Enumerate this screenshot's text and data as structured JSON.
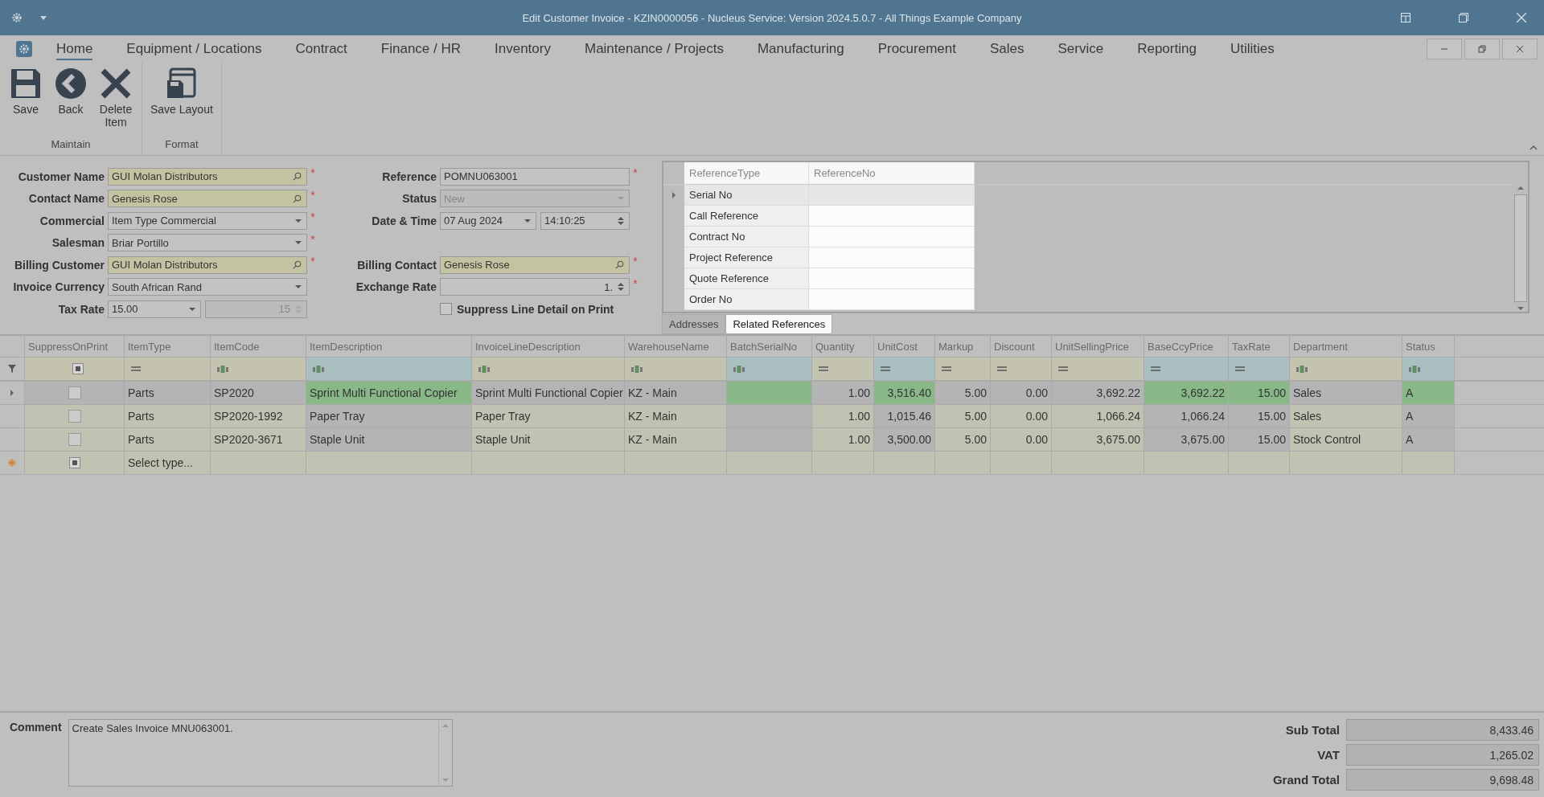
{
  "window": {
    "title": "Edit Customer Invoice - KZIN0000056 - Nucleus Service: Version 2024.5.0.7 - All Things Example Company"
  },
  "menu_tabs": [
    {
      "label": "Home",
      "selected": true
    },
    {
      "label": "Equipment / Locations",
      "selected": false
    },
    {
      "label": "Contract",
      "selected": false
    },
    {
      "label": "Finance / HR",
      "selected": false
    },
    {
      "label": "Inventory",
      "selected": false
    },
    {
      "label": "Maintenance / Projects",
      "selected": false
    },
    {
      "label": "Manufacturing",
      "selected": false
    },
    {
      "label": "Procurement",
      "selected": false
    },
    {
      "label": "Sales",
      "selected": false
    },
    {
      "label": "Service",
      "selected": false
    },
    {
      "label": "Reporting",
      "selected": false
    },
    {
      "label": "Utilities",
      "selected": false
    }
  ],
  "ribbon_groups": [
    {
      "label": "Maintain",
      "buttons": [
        {
          "kind": "save",
          "label": "Save"
        },
        {
          "kind": "back",
          "label": "Back"
        },
        {
          "kind": "delete",
          "label": "Delete Item"
        }
      ]
    },
    {
      "label": "Format",
      "buttons": [
        {
          "kind": "layout",
          "label": "Save Layout"
        }
      ]
    }
  ],
  "form_rows": [
    {
      "left": {
        "label": "Customer Name",
        "required_mark": "*",
        "fields": [
          {
            "kind": "search",
            "value": "GUI Molan Distributors",
            "disabled": false
          }
        ]
      },
      "right": {
        "label": "Reference",
        "required_mark": "*",
        "fields": [
          {
            "kind": "text",
            "value": "POMNU063001",
            "disabled": false
          }
        ]
      }
    },
    {
      "left": {
        "label": "Contact Name",
        "required_mark": "*",
        "fields": [
          {
            "kind": "search",
            "value": "Genesis Rose",
            "disabled": false
          }
        ]
      },
      "right": {
        "label": "Status",
        "fields": [
          {
            "kind": "dropdown",
            "value": "New",
            "disabled": true
          }
        ]
      }
    },
    {
      "left": {
        "label": "Commercial",
        "required_mark": "*",
        "fields": [
          {
            "kind": "dropdown",
            "value": "Item Type Commercial",
            "disabled": false
          }
        ]
      },
      "right": {
        "label": "Date & Time",
        "fields": [
          {
            "kind": "dropdown",
            "value": "07 Aug 2024",
            "disabled": false
          },
          {
            "kind": "spin",
            "value": "14:10:25",
            "disabled": false
          }
        ]
      }
    },
    {
      "left": {
        "label": "Salesman",
        "required_mark": "*",
        "fields": [
          {
            "kind": "dropdown",
            "value": "Briar Portillo",
            "disabled": false
          }
        ]
      }
    },
    {
      "left": {
        "label": "Billing Customer",
        "required_mark": "*",
        "fields": [
          {
            "kind": "search",
            "value": "GUI Molan Distributors",
            "disabled": false
          }
        ]
      },
      "right": {
        "label": "Billing Contact",
        "required_mark": "*",
        "fields": [
          {
            "kind": "search",
            "value": "Genesis Rose",
            "disabled": false
          }
        ]
      }
    },
    {
      "left": {
        "label": "Invoice Currency",
        "fields": [
          {
            "kind": "dropdown",
            "value": "South African Rand",
            "disabled": false
          }
        ]
      },
      "right": {
        "label": "Exchange Rate",
        "required_mark": "*",
        "fields": [
          {
            "kind": "spin-number",
            "value": "1.",
            "disabled": false
          }
        ]
      }
    },
    {
      "left": {
        "label": "Tax Rate",
        "fields": [
          {
            "kind": "dropdown",
            "value": "15.00",
            "disabled": false
          },
          {
            "kind": "spin-number",
            "value": "15",
            "disabled": true
          }
        ]
      },
      "right": {
        "checkbox": {
          "label": "Suppress Line Detail on Print",
          "checked": false
        }
      }
    }
  ],
  "references": {
    "columns": [
      "ReferenceType",
      "ReferenceNo"
    ],
    "rows": [
      {
        "type": "Serial No",
        "selected": true
      },
      {
        "type": "Call Reference",
        "selected": false
      },
      {
        "type": "Contract No",
        "selected": false
      },
      {
        "type": "Project Reference",
        "selected": false
      },
      {
        "type": "Quote Reference",
        "selected": false
      },
      {
        "type": "Order No",
        "selected": false
      }
    ],
    "tabs": [
      {
        "label": "Addresses",
        "selected": false
      },
      {
        "label": "Related References",
        "selected": true
      }
    ]
  },
  "grid": {
    "columns": [
      {
        "label": "SuppressOnPrint",
        "kind": "check",
        "highlighted": false
      },
      {
        "label": "ItemType",
        "kind": "text",
        "highlighted": false
      },
      {
        "label": "ItemCode",
        "kind": "text",
        "highlighted": false
      },
      {
        "label": "ItemDescription",
        "kind": "text",
        "highlighted": true
      },
      {
        "label": "InvoiceLineDescription",
        "kind": "text",
        "highlighted": false
      },
      {
        "label": "WarehouseName",
        "kind": "text",
        "highlighted": false
      },
      {
        "label": "BatchSerialNo",
        "kind": "text",
        "highlighted": true
      },
      {
        "label": "Quantity",
        "kind": "number",
        "highlighted": false
      },
      {
        "label": "UnitCost",
        "kind": "number",
        "highlighted": true
      },
      {
        "label": "Markup",
        "kind": "number",
        "highlighted": false
      },
      {
        "label": "Discount",
        "kind": "number",
        "highlighted": false
      },
      {
        "label": "UnitSellingPrice",
        "kind": "number",
        "highlighted": false
      },
      {
        "label": "BaseCcyPrice",
        "kind": "number",
        "highlighted": true
      },
      {
        "label": "TaxRate",
        "kind": "number",
        "highlighted": true
      },
      {
        "label": "Department",
        "kind": "text",
        "highlighted": false
      },
      {
        "label": "Status",
        "kind": "text",
        "highlighted": true
      }
    ],
    "filter_row": [
      {
        "kind": "check"
      },
      {
        "kind": "equals"
      },
      {
        "kind": "abc"
      },
      {
        "kind": "abc"
      },
      {
        "kind": "abc"
      },
      {
        "kind": "abc"
      },
      {
        "kind": "abc"
      },
      {
        "kind": "equals"
      },
      {
        "kind": "equals"
      },
      {
        "kind": "equals"
      },
      {
        "kind": "equals"
      },
      {
        "kind": "equals"
      },
      {
        "kind": "equals"
      },
      {
        "kind": "equals"
      },
      {
        "kind": "abc"
      },
      {
        "kind": "abc"
      }
    ],
    "rows": [
      {
        "selected": true,
        "checked": false,
        "cells": [
          "",
          "Parts",
          "SP2020",
          "Sprint Multi Functional Copier",
          "Sprint Multi Functional Copier",
          "KZ - Main",
          "",
          "1.00",
          "3,516.40",
          "5.00",
          "0.00",
          "3,692.22",
          "3,692.22",
          "15.00",
          "Sales",
          "A"
        ]
      },
      {
        "selected": false,
        "checked": false,
        "cells": [
          "",
          "Parts",
          "SP2020-1992",
          "Paper Tray",
          "Paper Tray",
          "KZ - Main",
          "",
          "1.00",
          "1,015.46",
          "5.00",
          "0.00",
          "1,066.24",
          "1,066.24",
          "15.00",
          "Sales",
          "A"
        ]
      },
      {
        "selected": false,
        "checked": false,
        "cells": [
          "",
          "Parts",
          "SP2020-3671",
          "Staple Unit",
          "Staple Unit",
          "KZ - Main",
          "",
          "1.00",
          "3,500.00",
          "5.00",
          "0.00",
          "3,675.00",
          "3,675.00",
          "15.00",
          "Stock Control",
          "A"
        ]
      }
    ],
    "new_row": {
      "placeholder": "Select type..."
    }
  },
  "comment": {
    "label": "Comment",
    "value": "Create Sales Invoice MNU063001."
  },
  "totals": [
    {
      "label": "Sub Total",
      "value": "8,433.46"
    },
    {
      "label": "VAT",
      "value": "1,265.02"
    },
    {
      "label": "Grand Total",
      "value": "9,698.48"
    }
  ]
}
